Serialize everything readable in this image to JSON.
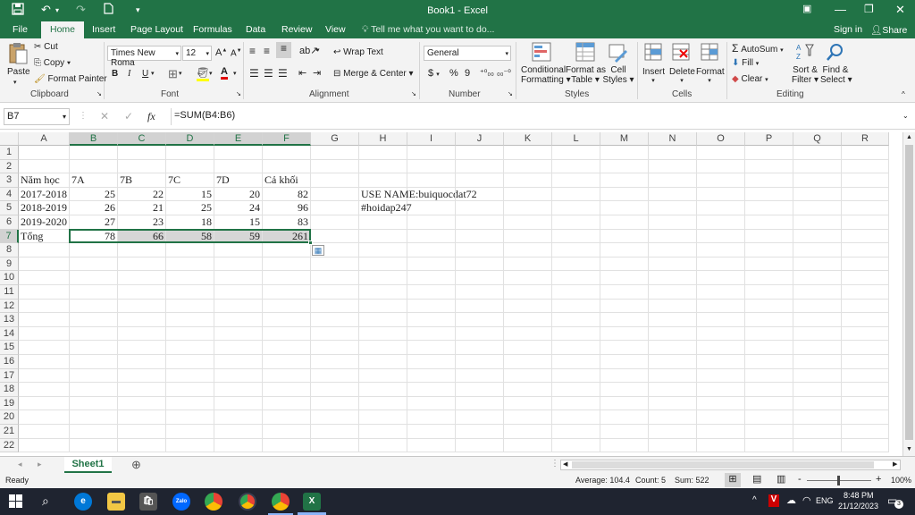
{
  "titlebar": {
    "title": "Book1 - Excel",
    "save_icon": "save-icon",
    "undo_icon": "undo-icon",
    "redo_icon": "redo-icon",
    "new_icon": "new-document-icon",
    "customize_icon": "customize-quick-access-icon"
  },
  "tabs": [
    {
      "label": "File"
    },
    {
      "label": "Home",
      "active": true
    },
    {
      "label": "Insert"
    },
    {
      "label": "Page Layout"
    },
    {
      "label": "Formulas"
    },
    {
      "label": "Data"
    },
    {
      "label": "Review"
    },
    {
      "label": "View"
    }
  ],
  "tell_me": "Tell me what you want to do...",
  "sign_in": "Sign in",
  "share": "Share",
  "ribbon": {
    "clipboard": {
      "label": "Clipboard",
      "paste": "Paste",
      "cut": "Cut",
      "copy": "Copy",
      "format_painter": "Format Painter"
    },
    "font": {
      "label": "Font",
      "name": "Times New Roma",
      "size": "12",
      "bold": "B",
      "italic": "I",
      "underline": "U"
    },
    "alignment": {
      "label": "Alignment",
      "wrap_text": "Wrap Text",
      "merge_center": "Merge & Center"
    },
    "number": {
      "label": "Number",
      "format": "General",
      "currency": "$",
      "percent": "%",
      "comma": "9"
    },
    "styles": {
      "label": "Styles",
      "conditional_1": "Conditional",
      "conditional_2": "Formatting",
      "format_table_1": "Format as",
      "format_table_2": "Table",
      "cell_styles_1": "Cell",
      "cell_styles_2": "Styles"
    },
    "cells": {
      "label": "Cells",
      "insert": "Insert",
      "delete": "Delete",
      "format": "Format"
    },
    "editing": {
      "label": "Editing",
      "autosum": "AutoSum",
      "fill": "Fill",
      "clear": "Clear",
      "sort_1": "Sort &",
      "sort_2": "Filter",
      "find_1": "Find &",
      "find_2": "Select"
    }
  },
  "formula_bar": {
    "name_box": "B7",
    "fx": "fx",
    "formula": "=SUM(B4:B6)"
  },
  "columns": [
    "A",
    "B",
    "C",
    "D",
    "E",
    "F",
    "G",
    "H",
    "I",
    "J",
    "K",
    "L",
    "M",
    "N",
    "O",
    "P",
    "Q",
    "R"
  ],
  "rows": [
    "1",
    "2",
    "3",
    "4",
    "5",
    "6",
    "7",
    "8",
    "9",
    "10",
    "11",
    "12",
    "13",
    "14",
    "15",
    "16",
    "17",
    "18",
    "19",
    "20",
    "21",
    "22"
  ],
  "cells": {
    "A3": "Năm học",
    "B3": "7A",
    "C3": "7B",
    "D3": "7C",
    "E3": "7D",
    "F3": "Cả khối",
    "A4": "2017-2018",
    "B4": "25",
    "C4": "22",
    "D4": "15",
    "E4": "20",
    "F4": "82",
    "A5": "2018-2019",
    "B5": "26",
    "C5": "21",
    "D5": "25",
    "E5": "24",
    "F5": "96",
    "A6": "2019-2020",
    "B6": "27",
    "C6": "23",
    "D6": "18",
    "E6": "15",
    "F6": "83",
    "A7": "Tổng",
    "B7": "78",
    "C7": "66",
    "D7": "58",
    "E7": "59",
    "F7": "261",
    "H4": "USE NAME:buiquocdat72",
    "H5": "#hoidap247"
  },
  "sheet_tab": "Sheet1",
  "status": {
    "ready": "Ready",
    "average": "Average: 104.4",
    "count": "Count: 5",
    "sum": "Sum: 522",
    "zoom": "100%",
    "minus": "-",
    "plus": "+"
  },
  "taskbar": {
    "time": "8:48 PM",
    "date": "21/12/2023",
    "lang": "ENG",
    "notifications": "3",
    "zalo": "Zalo"
  },
  "colors": {
    "accent": "#217346",
    "taskbar": "#1f2430"
  }
}
